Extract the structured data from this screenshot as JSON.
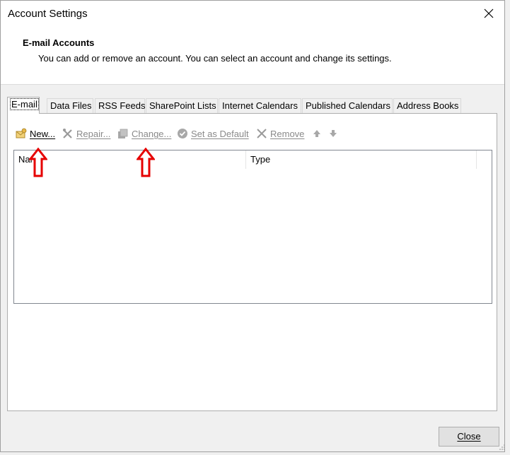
{
  "window": {
    "title": "Account Settings"
  },
  "header": {
    "title": "E-mail Accounts",
    "subtitle": "You can add or remove an account. You can select an account and change its settings."
  },
  "tabs": [
    {
      "label": "E-mail",
      "active": true
    },
    {
      "label": "Data Files",
      "active": false
    },
    {
      "label": "RSS Feeds",
      "active": false
    },
    {
      "label": "SharePoint Lists",
      "active": false
    },
    {
      "label": "Internet Calendars",
      "active": false
    },
    {
      "label": "Published Calendars",
      "active": false
    },
    {
      "label": "Address Books",
      "active": false
    }
  ],
  "toolbar": {
    "new": "New...",
    "repair": "Repair...",
    "change": "Change...",
    "set_default": "Set as Default",
    "remove": "Remove"
  },
  "list": {
    "columns": [
      "Name",
      "Type"
    ]
  },
  "footer": {
    "close_label": "Close"
  },
  "annotations": {
    "arrow_color": "#e60000"
  }
}
